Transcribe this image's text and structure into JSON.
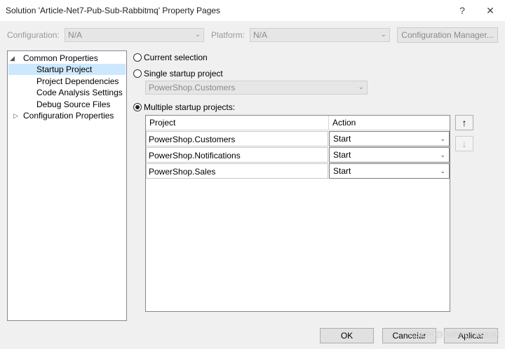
{
  "window": {
    "title": "Solution 'Article-Net7-Pub-Sub-Rabbitmq' Property Pages",
    "help_glyph": "?",
    "close_glyph": "✕"
  },
  "toolbar": {
    "configuration_label": "Configuration:",
    "configuration_value": "N/A",
    "platform_label": "Platform:",
    "platform_value": "N/A",
    "configuration_manager_label": "Configuration Manager..."
  },
  "tree": {
    "common_properties": "Common Properties",
    "startup_project": "Startup Project",
    "project_dependencies": "Project Dependencies",
    "code_analysis_settings": "Code Analysis Settings",
    "debug_source_files": "Debug Source Files",
    "configuration_properties": "Configuration Properties"
  },
  "options": {
    "current_selection": "Current selection",
    "single_startup": "Single startup project",
    "single_value": "PowerShop.Customers",
    "multiple_startup": "Multiple startup projects:",
    "selected": "multiple"
  },
  "grid": {
    "columns": [
      "Project",
      "Action"
    ],
    "rows": [
      {
        "project": "PowerShop.Customers",
        "action": "Start"
      },
      {
        "project": "PowerShop.Notifications",
        "action": "Start"
      },
      {
        "project": "PowerShop.Sales",
        "action": "Start"
      }
    ]
  },
  "buttons": {
    "ok": "OK",
    "cancel": "Cancelar",
    "apply": "Aplicar"
  },
  "icons": {
    "move_up": "↑",
    "move_down": "↓",
    "dropdown": "⌄"
  },
  "watermark": "CSDN @hefeng_aspnet"
}
